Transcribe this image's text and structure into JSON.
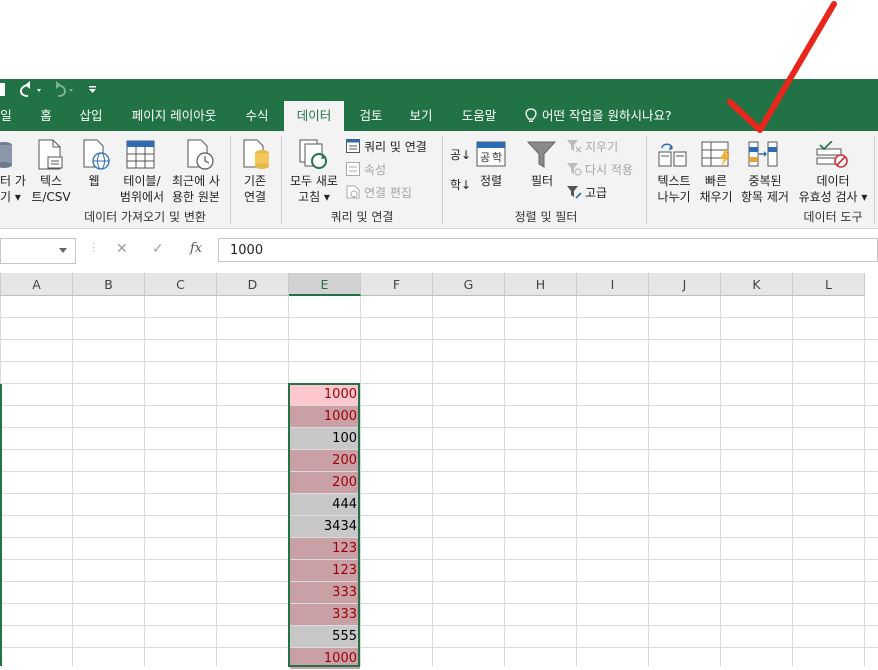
{
  "tabs": [
    {
      "label": "일",
      "active": false
    },
    {
      "label": "홈",
      "active": false
    },
    {
      "label": "삽입",
      "active": false
    },
    {
      "label": "페이지 레이아웃",
      "active": false
    },
    {
      "label": "수식",
      "active": false
    },
    {
      "label": "데이터",
      "active": true
    },
    {
      "label": "검토",
      "active": false
    },
    {
      "label": "보기",
      "active": false
    },
    {
      "label": "도움말",
      "active": false
    }
  ],
  "tell_me": "어떤 작업을 원하시나요?",
  "ribbon": {
    "get_data": {
      "from_text_l1": "터 가",
      "from_text_l2": "기 ▾",
      "text_csv_l1": "텍스",
      "text_csv_l2": "트/CSV",
      "web": "웹",
      "table_l1": "테이블/",
      "table_l2": "범위에서",
      "recent_l1": "최근에 사",
      "recent_l2": "용한 원본",
      "existing_l1": "기존",
      "existing_l2": "연결",
      "group": "데이터 가져오기 및 변환"
    },
    "queries": {
      "refresh_l1": "모두 새로",
      "refresh_l2": "고침 ▾",
      "queries_conn": "쿼리 및 연결",
      "properties": "속성",
      "edit_links": "연결 편집",
      "group": "쿼리 및 연결"
    },
    "sort_filter": {
      "sort": "정렬",
      "filter": "필터",
      "clear": "지우기",
      "reapply": "다시 적용",
      "advanced": "고급",
      "az": "공↓",
      "za": "학↓",
      "group": "정렬 및 필터"
    },
    "data_tools": {
      "text_to_cols_l1": "텍스트",
      "text_to_cols_l2": "나누기",
      "flash_fill_l1": "빠른",
      "flash_fill_l2": "채우기",
      "remove_dup_l1": "중복된",
      "remove_dup_l2": "항목 제거",
      "validation_l1": "데이터",
      "validation_l2": "유효성 검사 ▾",
      "group": "데이터 도구"
    }
  },
  "formula_bar": {
    "value": "1000",
    "fx": "fx",
    "cancel": "✕",
    "enter": "✓"
  },
  "columns": [
    "A",
    "B",
    "C",
    "D",
    "E",
    "F",
    "G",
    "H",
    "I",
    "J",
    "K",
    "L"
  ],
  "selected_column": "E",
  "cells": [
    {
      "value": "1000",
      "style": "first"
    },
    {
      "value": "1000",
      "style": "dup"
    },
    {
      "value": "100",
      "style": "unique"
    },
    {
      "value": "200",
      "style": "dup"
    },
    {
      "value": "200",
      "style": "dup"
    },
    {
      "value": "444",
      "style": "unique"
    },
    {
      "value": "3434",
      "style": "unique"
    },
    {
      "value": "123",
      "style": "dup"
    },
    {
      "value": "123",
      "style": "dup"
    },
    {
      "value": "333",
      "style": "dup"
    },
    {
      "value": "333",
      "style": "dup"
    },
    {
      "value": "555",
      "style": "unique"
    },
    {
      "value": "1000",
      "style": "dup"
    }
  ],
  "colors": {
    "brand": "#217346",
    "dup_fill": "#c9a0a6",
    "dup_text": "#9c0006",
    "first_fill": "#ffc7ce",
    "unique_fill": "#c8c8c8",
    "annotation": "#e8261c"
  }
}
